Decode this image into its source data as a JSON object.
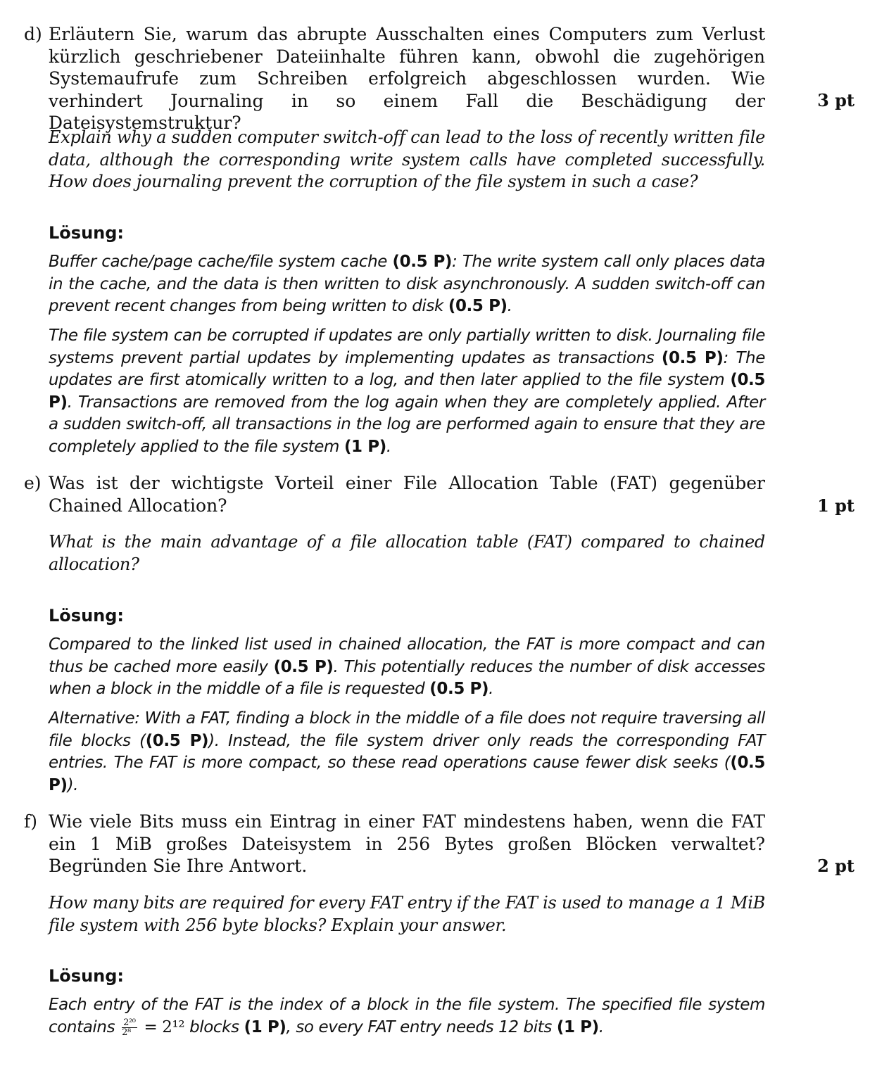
{
  "questions": [
    {
      "label": "d)",
      "german": "Erläutern Sie, warum das abrupte Ausschalten eines Computers zum Verlust kürzlich geschriebener Dateiinhalte führen kann, obwohl die zugehörigen Systemaufrufe zum Schreiben erfolgreich abgeschlossen wurden. Wie verhindert Journaling in so einem Fall die Beschädigung der Dateisystemstruktur?",
      "points": "3 pt",
      "english": "Explain why a sudden computer switch-off can lead to the loss of recently written file data, although the corresponding write system calls have completed successfully. How does journaling prevent the corruption of the file system in such a case?",
      "solution_heading": "Lösung:",
      "solution_paragraphs": [
        {
          "t1": "Buffer cache/page cache/file system cache ",
          "b1": "(0.5 P)",
          "t2": ": The write system call only places data in the cache, and the data is then written to disk asynchronously. A sudden switch-off can prevent recent changes from being written to disk ",
          "b2": "(0.5 P)",
          "t3": "."
        },
        {
          "t1": "The file system can be corrupted if updates are only partially written to disk. Journaling file systems prevent partial updates by implementing updates as transactions ",
          "b1": "(0.5 P)",
          "t2": ": The updates are first atomically written to a log, and then later applied to the file system ",
          "b2": "(0.5 P)",
          "t3": ". Transactions are removed from the log again when they are completely applied. After a sudden switch-off, all transactions in the log are performed again to ensure that they are completely applied to the file system ",
          "b3": "(1 P)",
          "t4": "."
        }
      ]
    },
    {
      "label": "e)",
      "german": "Was ist der wichtigste Vorteil einer File Allocation Table (FAT) gegenüber Chained Allocation?",
      "points": "1 pt",
      "english": "What is the main advantage of a file allocation table (FAT) compared to chained allocation?",
      "solution_heading": "Lösung:",
      "solution_paragraphs": [
        {
          "t1": "Compared to the linked list used in chained allocation, the FAT is more compact and can thus be cached more easily ",
          "b1": "(0.5 P)",
          "t2": ". This potentially reduces the number of disk accesses when a block in the middle of a file is requested ",
          "b2": "(0.5 P)",
          "t3": "."
        },
        {
          "t1": "Alternative: With a FAT, finding a block in the middle of a file does not require traversing all file blocks (",
          "b1": "(0.5 P)",
          "t2": "). Instead, the file system driver only reads the corresponding FAT entries. The FAT is more compact, so these read operations cause fewer disk seeks (",
          "b2": "(0.5 P)",
          "t3": ")."
        }
      ]
    },
    {
      "label": "f)",
      "german": "Wie viele Bits muss ein Eintrag in einer FAT mindestens haben, wenn die FAT ein 1 MiB großes Dateisystem in 256 Bytes großen Blöcken verwaltet? Begründen Sie Ihre Antwort.",
      "points": "2 pt",
      "english": "How many bits are required for every FAT entry if the FAT is used to manage a 1 MiB file system with 256 byte blocks? Explain your answer.",
      "solution_heading": "Lösung:",
      "solution_paragraphs": [
        {
          "t1": "Each entry of the FAT is the index of a block in the file system. The specified file system contains ",
          "frac_num": "2²⁰",
          "frac_den": "2⁸",
          "eq": " = 2¹² ",
          "t2": "blocks ",
          "b1": "(1 P)",
          "t3": ", so every FAT entry needs 12 bits ",
          "b2": "(1 P)",
          "t4": "."
        }
      ]
    }
  ]
}
